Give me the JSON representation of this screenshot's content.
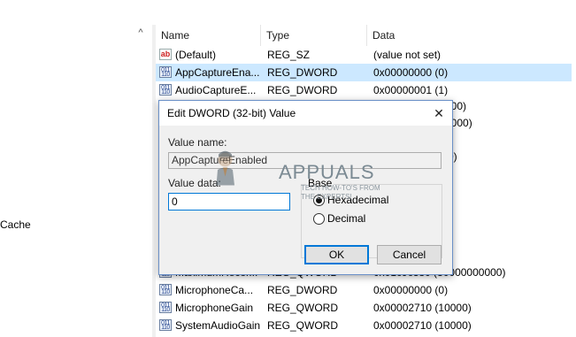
{
  "tree": {
    "visible_item": "Cache",
    "scroll_up_glyph": "^"
  },
  "list": {
    "columns": {
      "name": "Name",
      "type": "Type",
      "data": "Data"
    },
    "rows": [
      {
        "icon": "string-value-icon",
        "icon_glyph": "ab",
        "name": "(Default)",
        "type": "REG_SZ",
        "data": "(value not set)",
        "selected": false
      },
      {
        "icon": "binary-value-icon",
        "icon_glyph": "011 110",
        "name": "AppCaptureEna...",
        "type": "REG_DWORD",
        "data": "0x00000000 (0)",
        "selected": true
      },
      {
        "icon": "binary-value-icon",
        "icon_glyph": "011 110",
        "name": "AudioCaptureE...",
        "type": "REG_DWORD",
        "data": "0x00000001 (1)",
        "selected": false
      },
      {
        "icon": "binary-value-icon",
        "icon_glyph": "011 110",
        "name": "",
        "type": "",
        "data": "000)",
        "selected": false
      },
      {
        "icon": "binary-value-icon",
        "icon_glyph": "011 110",
        "name": "",
        "type": "",
        "data": "0000)",
        "selected": false
      },
      {
        "icon": "binary-value-icon",
        "icon_glyph": "011 110",
        "name": "",
        "type": "",
        "data": "0)",
        "selected": false
      },
      {
        "icon": "binary-value-icon",
        "icon_glyph": "011 110",
        "name": "MaximumRecor...",
        "type": "REG_QWORD",
        "data": "0x01c9c380 (30000000000)",
        "selected": false
      },
      {
        "icon": "binary-value-icon",
        "icon_glyph": "011 110",
        "name": "MicrophoneCa...",
        "type": "REG_DWORD",
        "data": "0x00000000 (0)",
        "selected": false
      },
      {
        "icon": "binary-value-icon",
        "icon_glyph": "011 110",
        "name": "MicrophoneGain",
        "type": "REG_QWORD",
        "data": "0x00002710 (10000)",
        "selected": false
      },
      {
        "icon": "binary-value-icon",
        "icon_glyph": "011 110",
        "name": "SystemAudioGain",
        "type": "REG_QWORD",
        "data": "0x00002710 (10000)",
        "selected": false
      }
    ]
  },
  "dialog": {
    "title": "Edit DWORD (32-bit) Value",
    "close_glyph": "✕",
    "value_name_label": "Value name:",
    "value_name": "AppCaptureEnabled",
    "value_data_label": "Value data:",
    "value_data": "0",
    "base_label": "Base",
    "base_options": [
      "Hexadecimal",
      "Decimal"
    ],
    "base_selected": "Hexadecimal",
    "ok_label": "OK",
    "cancel_label": "Cancel"
  },
  "watermark": {
    "brand": "APPUALS",
    "tagline": "TECH HOW-TO'S FROM THE EXPERTS!"
  },
  "colors": {
    "selection": "#cce8ff",
    "accent": "#0078d7"
  }
}
